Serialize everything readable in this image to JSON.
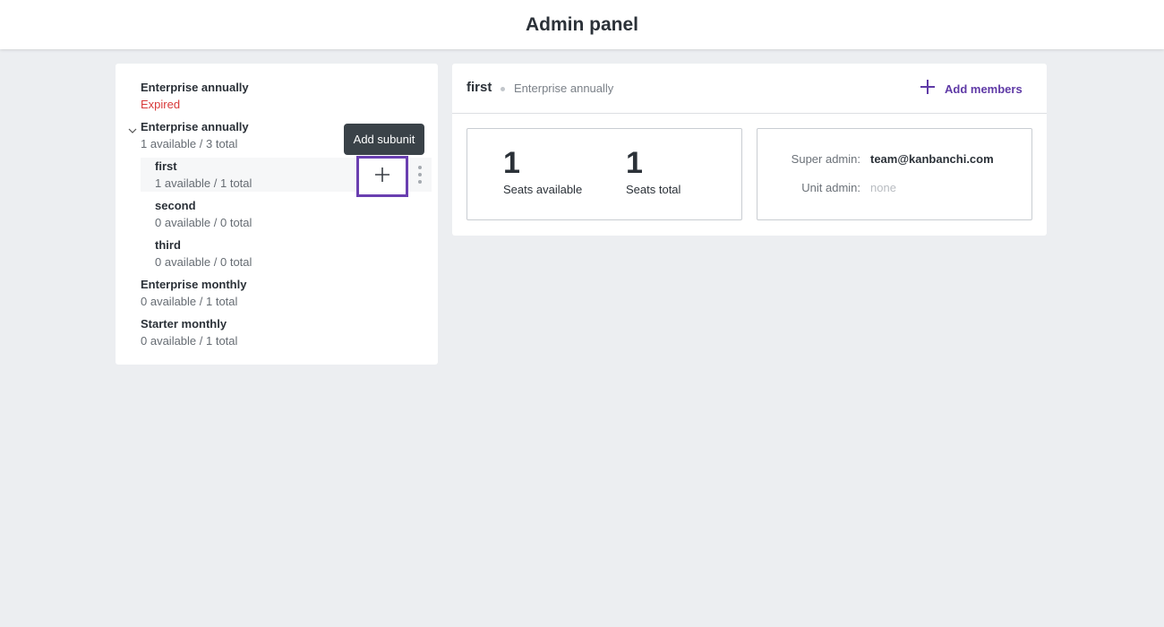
{
  "header": {
    "title": "Admin panel"
  },
  "subscriptions": [
    {
      "name": "Enterprise annually",
      "status": "Expired"
    },
    {
      "name": "Enterprise annually",
      "seats": "1 available / 3 total",
      "subunits": [
        {
          "name": "first",
          "seats": "1 available / 1 total"
        },
        {
          "name": "second",
          "seats": "0 available / 0 total"
        },
        {
          "name": "third",
          "seats": "0 available / 0 total"
        }
      ]
    },
    {
      "name": "Enterprise monthly",
      "seats": "0 available / 1 total"
    },
    {
      "name": "Starter monthly",
      "seats": "0 available / 1 total"
    }
  ],
  "tooltip": {
    "text": "Add subunit"
  },
  "detail": {
    "title": "first",
    "subtitle": "Enterprise annually",
    "add_members_label": "Add members",
    "seats_available": {
      "value": "1",
      "label": "Seats available"
    },
    "seats_total": {
      "value": "1",
      "label": "Seats total"
    },
    "super_admin": {
      "label": "Super admin:",
      "value": "team@kanbanchi.com"
    },
    "unit_admin": {
      "label": "Unit admin:",
      "value": "none"
    }
  },
  "colors": {
    "accent": "#6a3fb0",
    "expired": "#d83a3a",
    "background": "#eceef1"
  }
}
